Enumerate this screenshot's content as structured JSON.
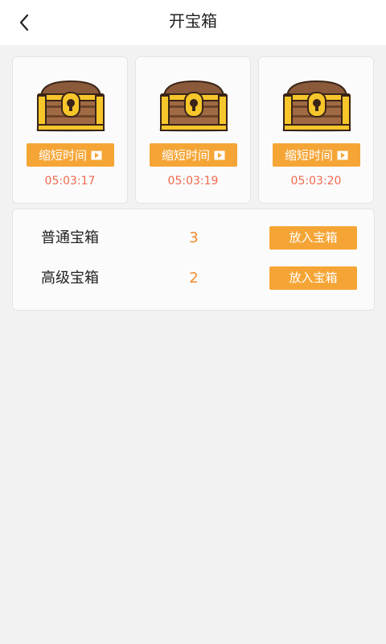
{
  "header": {
    "title": "开宝箱",
    "back_icon": "chevron-left-icon"
  },
  "chests": [
    {
      "icon": "treasure-chest-icon",
      "button_label": "缩短时间",
      "button_icon": "play-icon",
      "timer": "05:03:17"
    },
    {
      "icon": "treasure-chest-icon",
      "button_label": "缩短时间",
      "button_icon": "play-icon",
      "timer": "05:03:19"
    },
    {
      "icon": "treasure-chest-icon",
      "button_label": "缩短时间",
      "button_icon": "play-icon",
      "timer": "05:03:20"
    }
  ],
  "inventory": [
    {
      "label": "普通宝箱",
      "count": "3",
      "button_label": "放入宝箱"
    },
    {
      "label": "高级宝箱",
      "count": "2",
      "button_label": "放入宝箱"
    }
  ],
  "colors": {
    "accent": "#f5a536",
    "timer": "#f06a50",
    "count": "#f08a2a",
    "background": "#f2f2f2"
  }
}
